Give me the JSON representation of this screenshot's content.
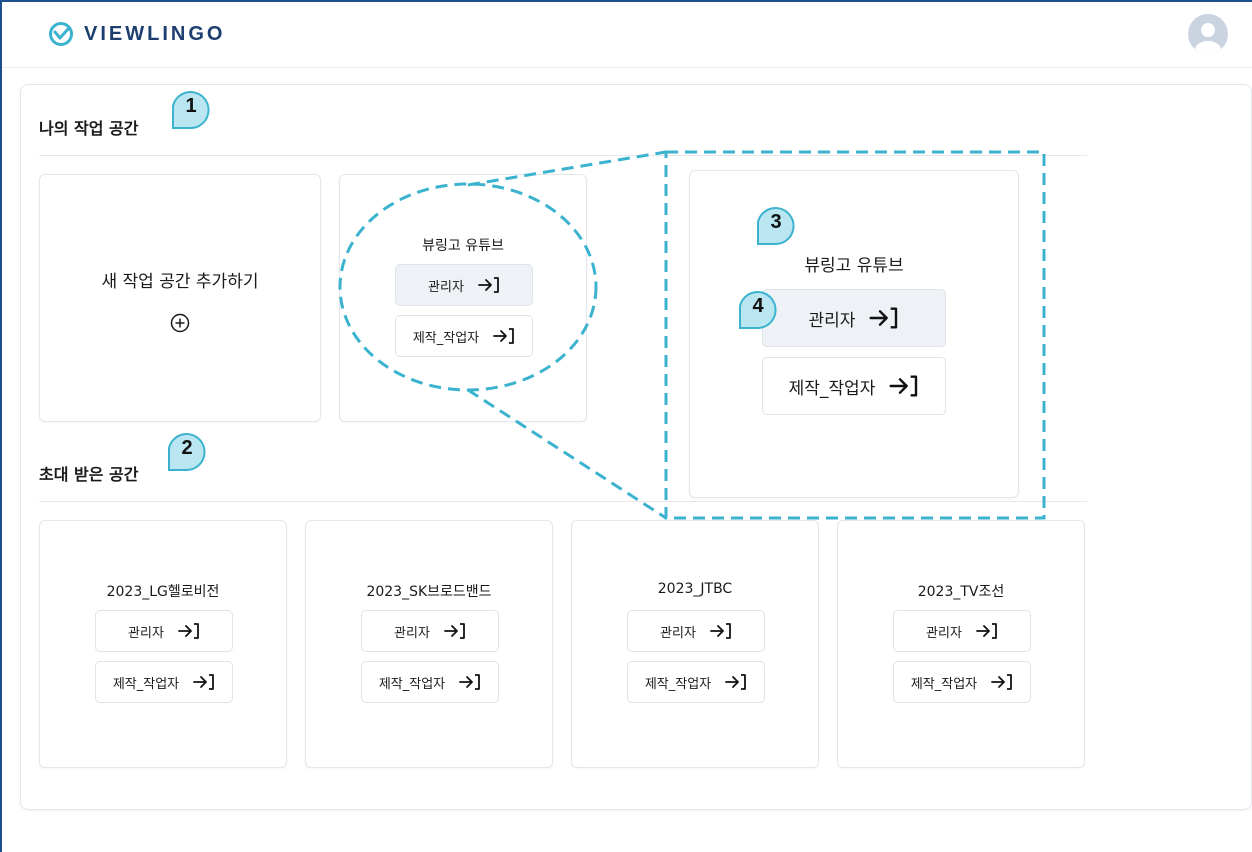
{
  "app": {
    "logo_text": "VIEWLINGO",
    "brand_color": "#1d3e6e",
    "accent_color": "#3bb3cf"
  },
  "header": {
    "avatar_icon": "user-avatar-icon"
  },
  "my_workspaces": {
    "title": "나의 작업 공간",
    "add_card_label": "새 작업 공간 추가하기",
    "add_icon": "plus-circle-icon",
    "workspace": {
      "name": "뷰링고 유튜브",
      "admin_label": "관리자",
      "worker_label": "제작_작업자"
    }
  },
  "zoom_callout": {
    "name": "뷰링고 유튜브",
    "admin_label": "관리자",
    "worker_label": "제작_작업자"
  },
  "invited_workspaces": {
    "title": "초대 받은 공간",
    "items": [
      {
        "name": "2023_LG헬로비전",
        "admin_label": "관리자",
        "worker_label": "제작_작업자"
      },
      {
        "name": "2023_SK브로드밴드",
        "admin_label": "관리자",
        "worker_label": "제작_작업자"
      },
      {
        "name": "2023_JTBC",
        "admin_label": "관리자",
        "worker_label": "제작_작업자"
      },
      {
        "name": "2023_TV조선",
        "admin_label": "관리자",
        "worker_label": "제작_작업자"
      }
    ]
  },
  "annotations": {
    "badge1": "1",
    "badge2": "2",
    "badge3": "3",
    "badge4": "4"
  },
  "icons": {
    "enter": "enter-arrow-icon",
    "logo": "viewlingo-logo-icon"
  }
}
